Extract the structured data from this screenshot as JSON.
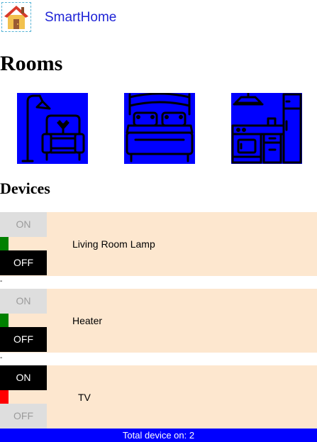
{
  "header": {
    "logo_icon": "house-icon",
    "app_title": "SmartHome"
  },
  "rooms": {
    "title": "Rooms",
    "tiles": [
      {
        "icon": "living-room-icon",
        "color": "#0000ff"
      },
      {
        "icon": "bedroom-icon",
        "color": "#0000ff"
      },
      {
        "icon": "kitchen-icon",
        "color": "#0000ff"
      }
    ]
  },
  "devices": {
    "title": "Devices",
    "separator": "-",
    "on_label": "ON",
    "off_label": "OFF",
    "items": [
      {
        "name": "Living Room Lamp",
        "state": "off",
        "status_color": "#008000"
      },
      {
        "name": "Heater",
        "state": "off",
        "status_color": "#008000"
      },
      {
        "name": "TV",
        "state": "on",
        "status_color": "#ff0000"
      }
    ]
  },
  "footer": {
    "total_on_text": "Total device on: 2"
  },
  "colors": {
    "title": "#1f24d6",
    "room_tile": "#0000ff",
    "device_row_bg": "#fde7cf",
    "active_button": "#000000",
    "inactive_button": "#dedede",
    "footer_bg": "#0000ff"
  }
}
